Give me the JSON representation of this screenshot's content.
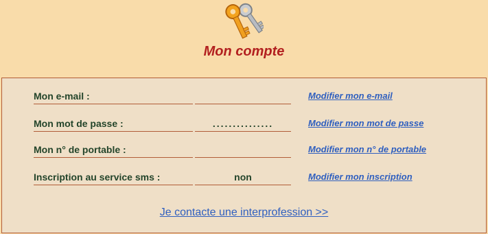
{
  "header": {
    "title": "Mon compte",
    "icon": "keys-icon"
  },
  "account": {
    "rows": [
      {
        "label": "Mon e-mail :",
        "value": "",
        "link": "Modifier mon e-mail"
      },
      {
        "label": "Mon mot de passe :",
        "value": "...............",
        "link": "Modifier mon mot de passe"
      },
      {
        "label": "Mon n° de portable :",
        "value": "",
        "link": "Modifier mon n° de portable"
      },
      {
        "label": "Inscription au service sms :",
        "value": "non",
        "link": "Modifier mon inscription"
      }
    ],
    "contact_link": "Je contacte une interprofession >>"
  },
  "colors": {
    "background": "#f9dcaa",
    "panel": "#efdfc7",
    "title": "#b21f1f",
    "label_text": "#23442a",
    "link": "#2f5fbf",
    "border": "#b15c37"
  }
}
